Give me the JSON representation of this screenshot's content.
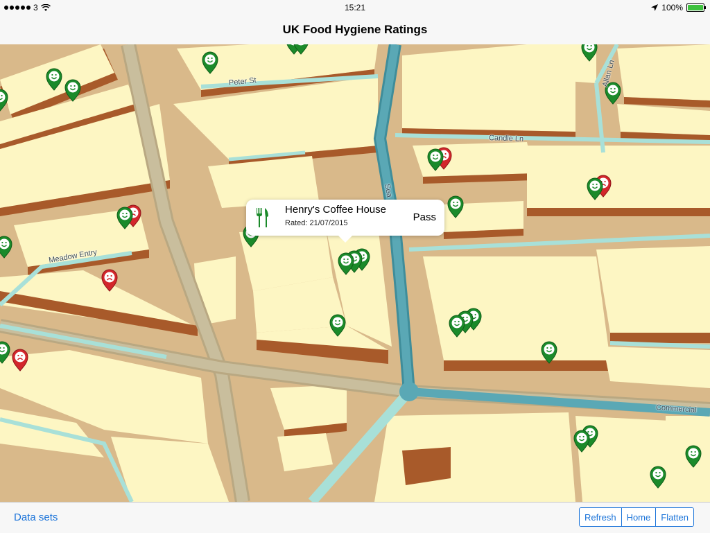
{
  "status_bar": {
    "carrier": "3",
    "time": "15:21",
    "battery": "100%",
    "signal_icon": "signal-dots-icon",
    "wifi_icon": "wifi-icon",
    "location_icon": "location-arrow-icon",
    "battery_icon": "battery-icon"
  },
  "nav": {
    "title": "UK Food Hygiene Ratings"
  },
  "map": {
    "street_labels": [
      "Peter St",
      "Allan Ln",
      "Candle Ln",
      "Sea",
      "Meadow Entry",
      "Commercial"
    ],
    "colors": {
      "building_top": "#fdf6c3",
      "building_side": "#a85a2a",
      "ground": "#d9b98a",
      "road": "#c7bd9e",
      "canal": "#5aa8b5",
      "path": "#a8e0d8",
      "pass_pin": "#1b8a2a",
      "fail_pin": "#d3262b"
    }
  },
  "callout": {
    "name": "Henry's Coffee House",
    "rated": "Rated: 21/07/2015",
    "result": "Pass",
    "icon": "cutlery-icon"
  },
  "toolbar": {
    "data_sets": "Data sets",
    "segments": [
      "Refresh",
      "Home",
      "Flatten"
    ]
  }
}
